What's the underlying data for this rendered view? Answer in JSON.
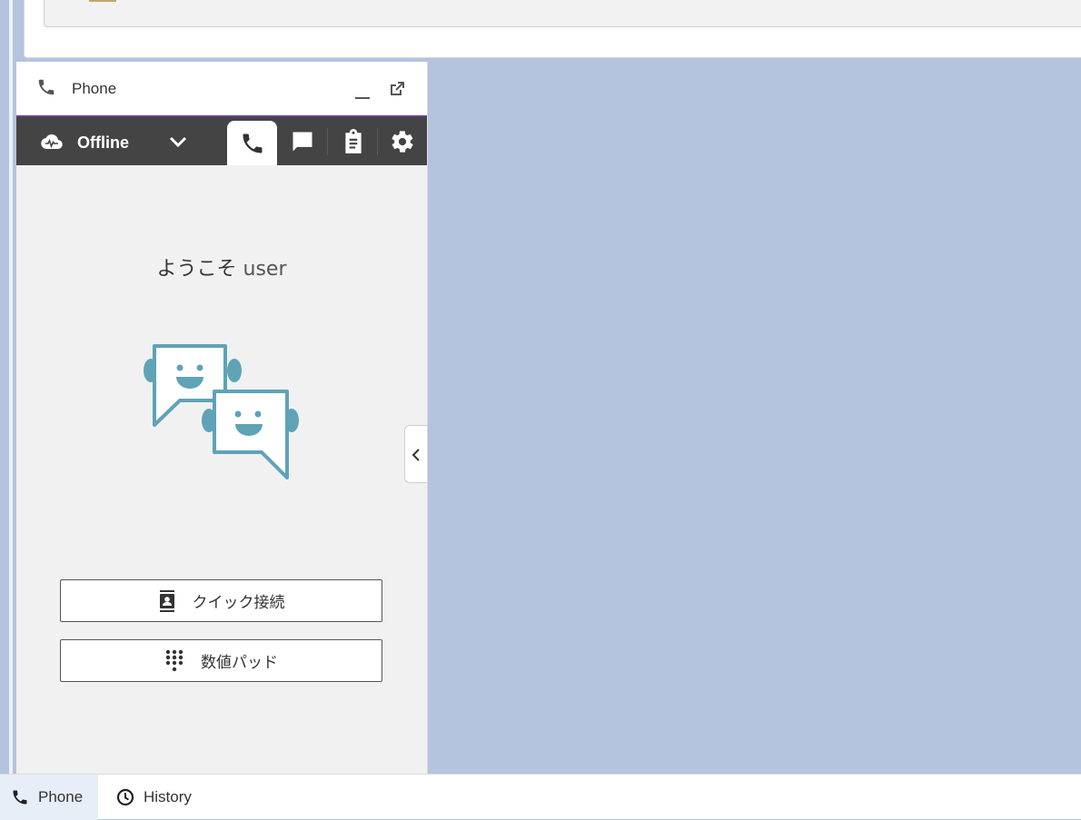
{
  "phone_panel": {
    "title": "Phone",
    "status": "Offline",
    "welcome_greeting": "ようこそ",
    "welcome_user": "user",
    "buttons": {
      "quick_connect": "クイック接続",
      "number_pad": "数値パッド"
    },
    "tabs": [
      {
        "icon": "phone-icon",
        "active": true
      },
      {
        "icon": "chat-icon",
        "active": false
      },
      {
        "icon": "clipboard-icon",
        "active": false
      },
      {
        "icon": "gear-icon",
        "active": false
      }
    ]
  },
  "bottom_bar": {
    "tabs": [
      {
        "label": "Phone",
        "icon": "phone-icon",
        "active": true
      },
      {
        "label": "History",
        "icon": "clock-icon",
        "active": false
      }
    ]
  },
  "colors": {
    "background": "#b4c4de",
    "toolbar": "#444444",
    "accent_border": "#6b3aa0",
    "illustration": "#5fa3b7"
  }
}
